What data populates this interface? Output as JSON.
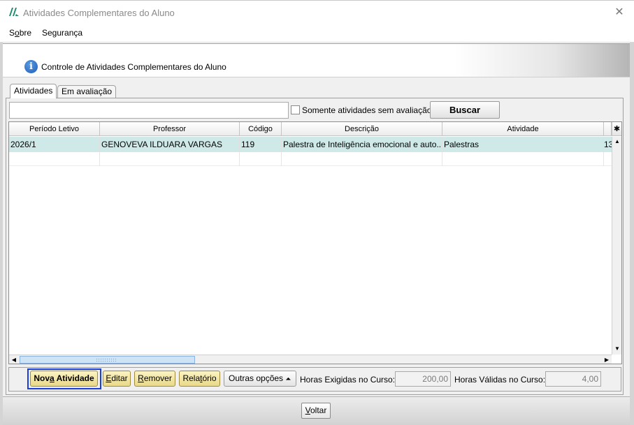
{
  "window": {
    "title": "Atividades Complementares do Aluno",
    "close_glyph": "✕"
  },
  "menu": {
    "sobre": {
      "first": "S",
      "ul": "o",
      "rest": "bre"
    },
    "seguranca": "Segurança"
  },
  "header": {
    "text": "Controle de Atividades Complementares do Aluno",
    "icon_glyph": "i"
  },
  "tabs": [
    {
      "label": "Atividades",
      "active": true
    },
    {
      "label": "Em avaliação",
      "active": false
    }
  ],
  "search": {
    "value": "",
    "checkbox_label": "Somente atividades sem avaliação",
    "checked": false,
    "button_label": "Buscar"
  },
  "table": {
    "columns": [
      "Período Letivo",
      "Professor",
      "Código",
      "Descrição",
      "Atividade"
    ],
    "settings_glyph": "✱",
    "rows": [
      {
        "periodo": "2026/1",
        "professor": "GENOVEVA ILDUARA VARGAS",
        "codigo": "119",
        "descricao": "Palestra de Inteligência emocional e auto...",
        "atividade": "Palestras",
        "extra": "13"
      }
    ]
  },
  "toolbar": {
    "nova": {
      "a": "Nov",
      "u": "a",
      "b": " Atividade"
    },
    "editar": {
      "u": "E",
      "b": "ditar"
    },
    "remover": {
      "u": "R",
      "b": "emover"
    },
    "relatorio": {
      "a": "Rela",
      "u": "t",
      "b": "ório"
    },
    "outras": "Outras opções",
    "outras_glyph": "⏶",
    "horas_exigidas_label": "Horas Exigidas no Curso:",
    "horas_exigidas_value": "200,00",
    "horas_validas_label": "Horas Válidas no Curso:",
    "horas_validas_value": "4,00"
  },
  "footer": {
    "voltar": {
      "u": "V",
      "b": "oltar"
    }
  },
  "scroll_glyphs": {
    "up": "▲",
    "down": "▼",
    "left": "◀",
    "right": "▶"
  }
}
